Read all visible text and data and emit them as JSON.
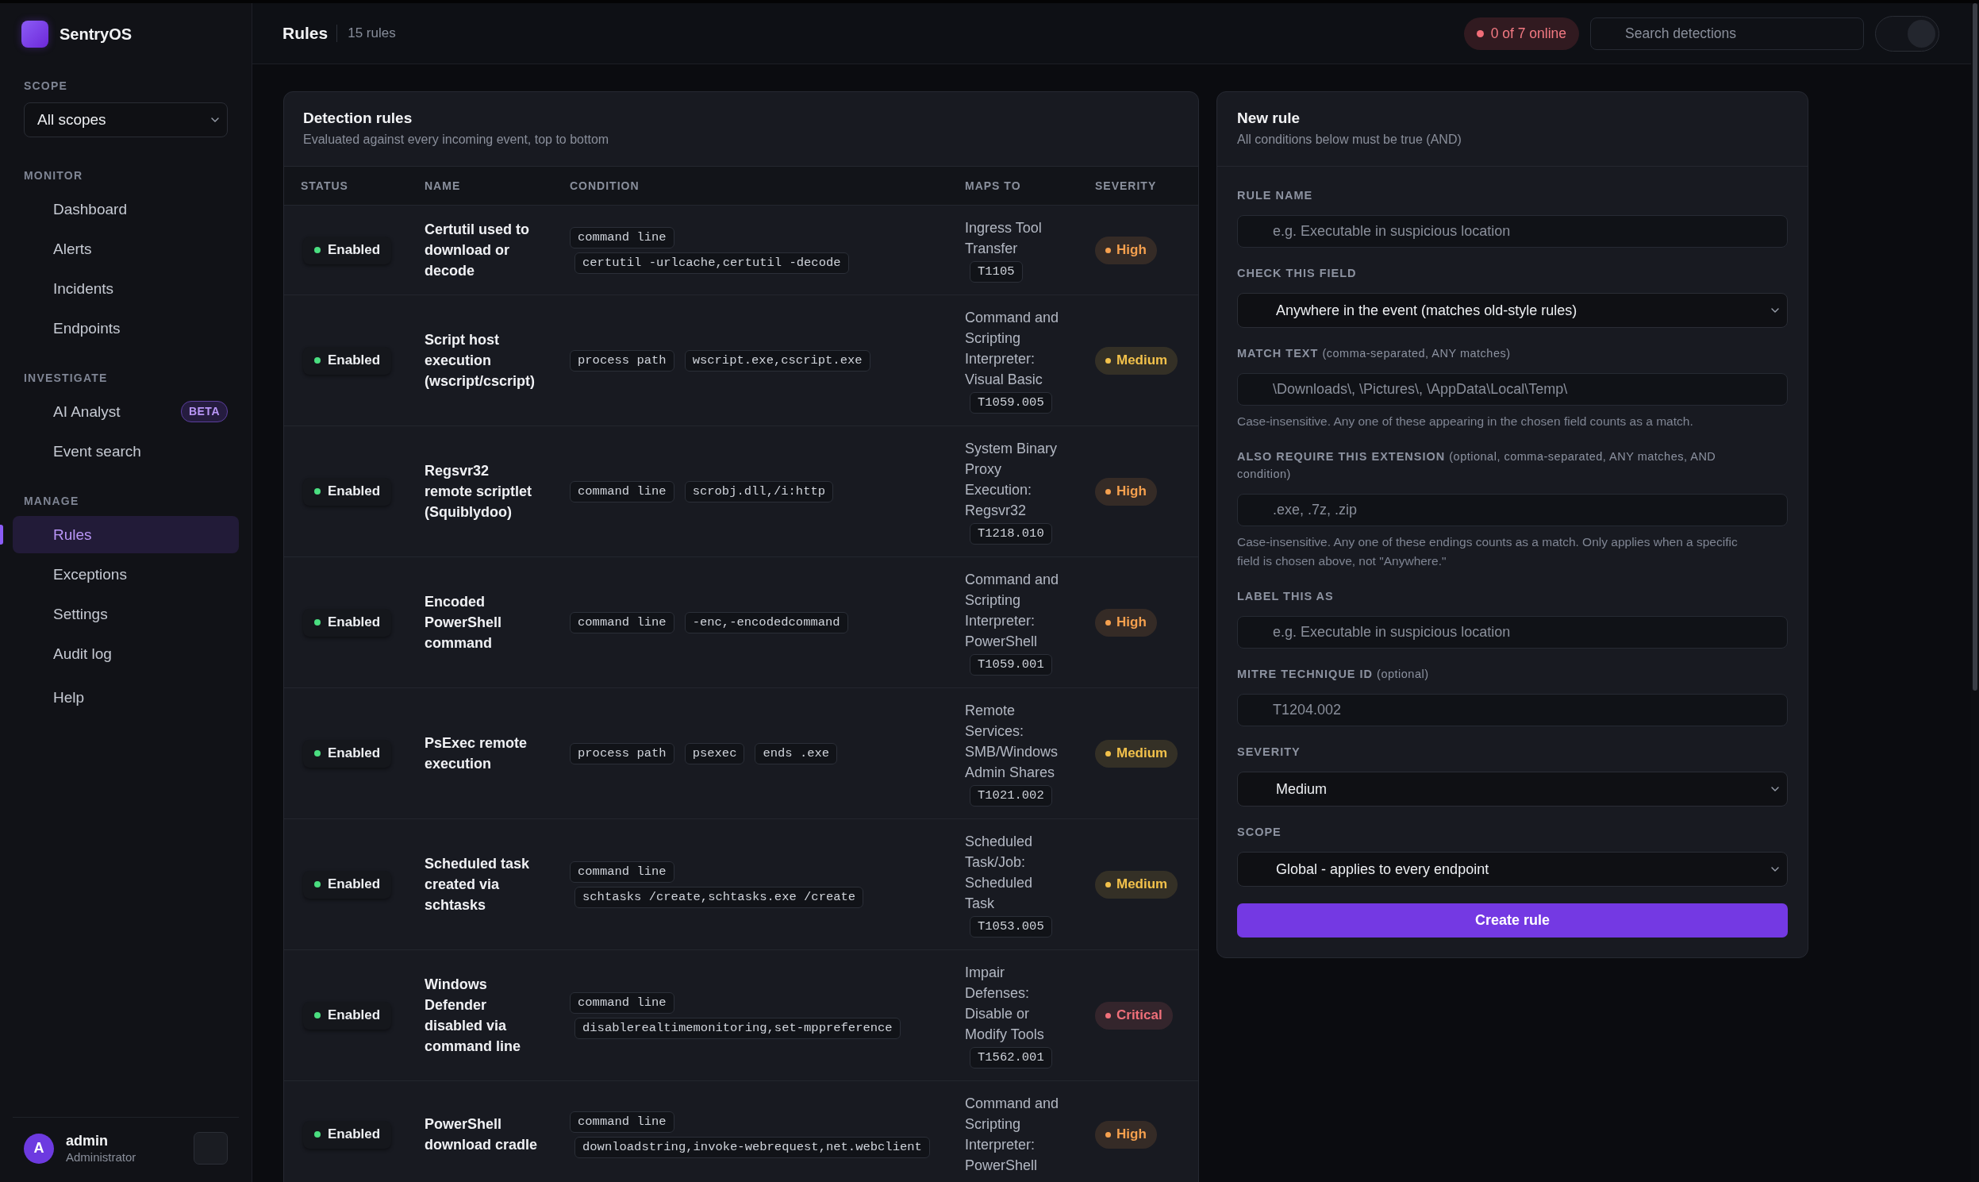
{
  "sidebar": {
    "brand": "SentryOS",
    "scope": {
      "label": "SCOPE",
      "value": "All scopes"
    },
    "sections": [
      {
        "title": "MONITOR",
        "items": [
          {
            "label": "Dashboard",
            "selected": false
          },
          {
            "label": "Alerts",
            "selected": false
          },
          {
            "label": "Incidents",
            "selected": false
          },
          {
            "label": "Endpoints",
            "selected": false
          }
        ]
      },
      {
        "title": "INVESTIGATE",
        "items": [
          {
            "label": "AI Analyst",
            "badge": "BETA",
            "selected": false
          },
          {
            "label": "Event search",
            "selected": false
          }
        ]
      },
      {
        "title": "MANAGE",
        "items": [
          {
            "label": "Rules",
            "selected": true
          },
          {
            "label": "Exceptions",
            "selected": false
          },
          {
            "label": "Settings",
            "selected": false
          },
          {
            "label": "Audit log",
            "selected": false
          }
        ]
      },
      {
        "items": [
          {
            "label": "Help",
            "selected": false
          }
        ]
      }
    ],
    "user": {
      "initial": "A",
      "name": "admin",
      "role": "Administrator"
    }
  },
  "header": {
    "title": "Rules",
    "count": "15 rules",
    "online": "0 of 7 online",
    "search": {
      "placeholder": "Search detections"
    },
    "toggle": {
      "on": true
    }
  },
  "rules_table": {
    "title": "Detection rules",
    "subtitle": "Evaluated against every incoming event, top to bottom",
    "columns": [
      "STATUS",
      "NAME",
      "CONDITION",
      "MAPS TO",
      "SEVERITY"
    ],
    "rows": [
      {
        "status": "Enabled",
        "enabled": true,
        "name": "Certutil used to download or decode",
        "condition": [
          "command line",
          "certutil -urlcache,certutil -decode"
        ],
        "maps_to": "Ingress Tool Transfer",
        "technique": "T1105",
        "severity": {
          "label": "High",
          "color": "#f5a04e"
        }
      },
      {
        "status": "Enabled",
        "enabled": true,
        "name": "Script host execution (wscript/cscript)",
        "condition": [
          "process path",
          "wscript.exe,cscript.exe"
        ],
        "maps_to": "Command and Scripting Interpreter: Visual Basic",
        "technique": "T1059.005",
        "severity": {
          "label": "Medium",
          "color": "#f2c14b"
        }
      },
      {
        "status": "Enabled",
        "enabled": true,
        "name": "Regsvr32 remote scriptlet (Squiblydoo)",
        "condition": [
          "command line",
          "scrobj.dll,/i:http"
        ],
        "maps_to": "System Binary Proxy Execution: Regsvr32",
        "technique": "T1218.010",
        "severity": {
          "label": "High",
          "color": "#f5a04e"
        }
      },
      {
        "status": "Enabled",
        "enabled": true,
        "name": "Encoded PowerShell command",
        "condition": [
          "command line",
          "-enc,-encodedcommand"
        ],
        "maps_to": "Command and Scripting Interpreter: PowerShell",
        "technique": "T1059.001",
        "severity": {
          "label": "High",
          "color": "#f5a04e"
        }
      },
      {
        "status": "Enabled",
        "enabled": true,
        "name": "PsExec remote execution",
        "condition": [
          "process path",
          "psexec",
          "ends .exe"
        ],
        "maps_to": "Remote Services: SMB/Windows Admin Shares",
        "technique": "T1021.002",
        "severity": {
          "label": "Medium",
          "color": "#f2c14b"
        }
      },
      {
        "status": "Enabled",
        "enabled": true,
        "name": "Scheduled task created via schtasks",
        "condition": [
          "command line",
          "schtasks /create,schtasks.exe /create"
        ],
        "maps_to": "Scheduled Task/Job: Scheduled Task",
        "technique": "T1053.005",
        "severity": {
          "label": "Medium",
          "color": "#f2c14b"
        }
      },
      {
        "status": "Enabled",
        "enabled": true,
        "name": "Windows Defender disabled via command line",
        "condition": [
          "command line",
          "disablerealtimemonitoring,set-mppreference"
        ],
        "maps_to": "Impair Defenses: Disable or Modify Tools",
        "technique": "T1562.001",
        "severity": {
          "label": "Critical",
          "color": "#f0707a"
        }
      },
      {
        "status": "Enabled",
        "enabled": true,
        "name": "PowerShell download cradle",
        "condition": [
          "command line",
          "downloadstring,invoke-webrequest,net.webclient"
        ],
        "maps_to": "Command and Scripting Interpreter: PowerShell",
        "severity": {
          "label": "High",
          "color": "#f5a04e"
        }
      }
    ]
  },
  "new_rule_form": {
    "title": "New rule",
    "subtitle": "All conditions below must be true (AND)",
    "fields": [
      {
        "kind": "input",
        "label": "RULE NAME",
        "placeholder": "e.g. Executable in suspicious location"
      },
      {
        "kind": "select",
        "label": "CHECK THIS FIELD",
        "value": "Anywhere in the event (matches old-style rules)"
      },
      {
        "kind": "input",
        "label": "MATCH TEXT",
        "note": "(comma-separated, ANY matches)",
        "placeholder": "\\Downloads\\, \\Pictures\\, \\AppData\\Local\\Temp\\",
        "help": "Case-insensitive. Any one of these appearing in the chosen field counts as a match."
      },
      {
        "kind": "input",
        "label": "ALSO REQUIRE THIS EXTENSION",
        "note": "(optional, comma-separated, ANY matches, AND condition)",
        "placeholder": ".exe, .7z, .zip",
        "help": "Case-insensitive. Any one of these endings counts as a match. Only applies when a specific field is chosen above, not \"Anywhere.\""
      },
      {
        "kind": "input",
        "label": "LABEL THIS AS",
        "placeholder": "e.g. Executable in suspicious location"
      },
      {
        "kind": "input",
        "label": "MITRE TECHNIQUE ID",
        "note": "(optional)",
        "placeholder": "T1204.002"
      },
      {
        "kind": "select",
        "label": "SEVERITY",
        "value": "Medium"
      },
      {
        "kind": "select",
        "label": "SCOPE",
        "value": "Global - applies to every endpoint"
      }
    ],
    "button": "Create rule"
  }
}
